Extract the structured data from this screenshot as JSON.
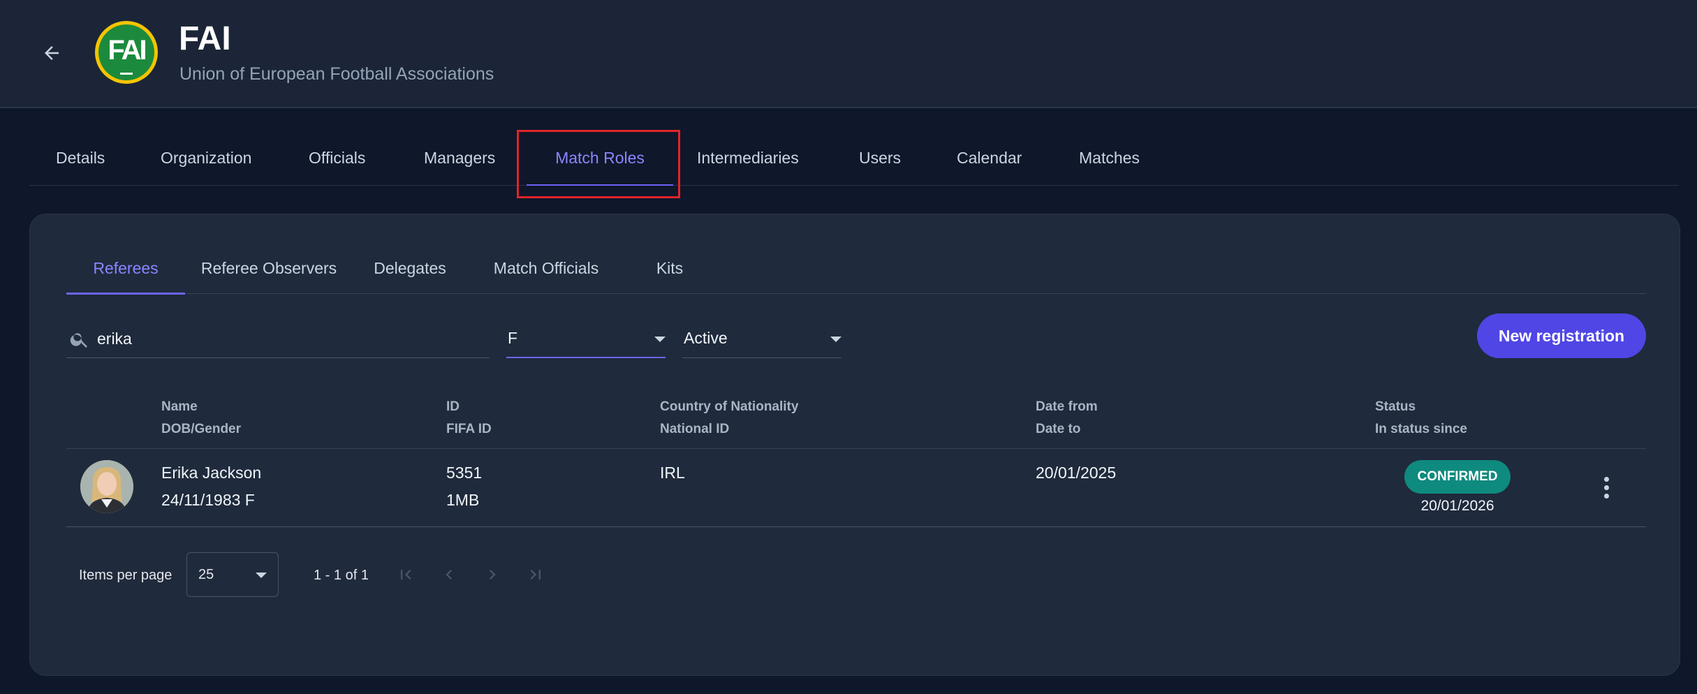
{
  "header": {
    "title": "FAI",
    "subtitle": "Union of European Football Associations",
    "logo_text": "FAI"
  },
  "top_tabs": [
    {
      "label": "Details",
      "active": false
    },
    {
      "label": "Organization",
      "active": false
    },
    {
      "label": "Officials",
      "active": false
    },
    {
      "label": "Managers",
      "active": false
    },
    {
      "label": "Match Roles",
      "active": true
    },
    {
      "label": "Intermediaries",
      "active": false
    },
    {
      "label": "Users",
      "active": false
    },
    {
      "label": "Calendar",
      "active": false
    },
    {
      "label": "Matches",
      "active": false
    }
  ],
  "sub_tabs": [
    {
      "label": "Referees",
      "active": true
    },
    {
      "label": "Referee Observers",
      "active": false
    },
    {
      "label": "Delegates",
      "active": false
    },
    {
      "label": "Match Officials",
      "active": false
    },
    {
      "label": "Kits",
      "active": false
    }
  ],
  "filters": {
    "search_value": "erika",
    "gender_value": "F",
    "status_value": "Active"
  },
  "actions": {
    "new_registration_label": "New registration"
  },
  "table": {
    "headers": {
      "name": "Name",
      "dob_gender": "DOB/Gender",
      "id": "ID",
      "fifa_id": "FIFA ID",
      "country": "Country of Nationality",
      "national_id": "National ID",
      "date_from": "Date from",
      "date_to": "Date to",
      "status": "Status",
      "status_since": "In status since"
    },
    "rows": [
      {
        "name": "Erika Jackson",
        "dob_gender": "24/11/1983 F",
        "id": "5351",
        "fifa_id": "1MB",
        "country": "IRL",
        "national_id": "",
        "date_from": "20/01/2025",
        "date_to": "",
        "status": "CONFIRMED",
        "status_since": "20/01/2026"
      }
    ]
  },
  "paginator": {
    "items_per_page_label": "Items per page",
    "items_per_page_value": "25",
    "range_label": "1 - 1 of 1"
  },
  "colors": {
    "accent": "#6d63f5",
    "status_confirmed": "#0f8a7e",
    "highlight": "#e0242a"
  }
}
